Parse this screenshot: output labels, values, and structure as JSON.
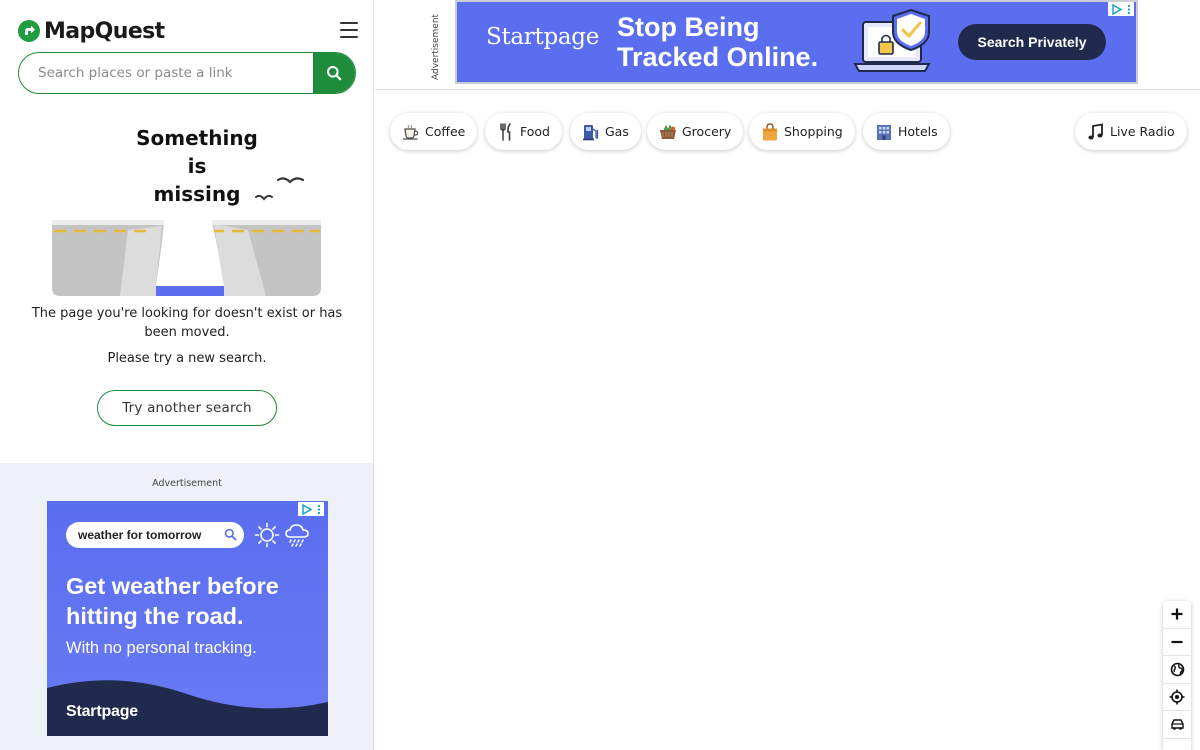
{
  "brand": {
    "name": "MapQuest"
  },
  "search": {
    "placeholder": "Search places or paste a link",
    "value": ""
  },
  "error": {
    "title_lines": [
      "Something",
      "is",
      "missing"
    ],
    "message": "The page you're looking for doesn't exist or has been moved.",
    "hint": "Please try a new search.",
    "button_label": "Try another search"
  },
  "side_ad": {
    "label": "Advertisement",
    "search_text": "weather for tomorrow",
    "headline": "Get weather before hitting the road.",
    "subtext": "With no personal tracking.",
    "brand": "Startpage"
  },
  "top_ad": {
    "label": "Advertisement",
    "brand": "Startpage",
    "headline_lines": [
      "Stop Being",
      "Tracked Online."
    ],
    "cta": "Search Privately"
  },
  "categories": [
    {
      "label": "Coffee",
      "icon": "coffee-cup-icon"
    },
    {
      "label": "Food",
      "icon": "fork-knife-icon"
    },
    {
      "label": "Gas",
      "icon": "gas-pump-icon"
    },
    {
      "label": "Grocery",
      "icon": "grocery-basket-icon"
    },
    {
      "label": "Shopping",
      "icon": "shopping-bag-icon"
    },
    {
      "label": "Hotels",
      "icon": "hotel-building-icon"
    }
  ],
  "live_radio": {
    "label": "Live Radio",
    "icon": "music-note-icon"
  },
  "map_controls": [
    "zoom-in-icon",
    "zoom-out-icon",
    "globe-icon",
    "locate-icon",
    "traffic-icon"
  ],
  "colors": {
    "brand_green": "#1e8c3a",
    "ad_blue": "#5b6ef0",
    "ad_navy": "#1f2a4d"
  }
}
